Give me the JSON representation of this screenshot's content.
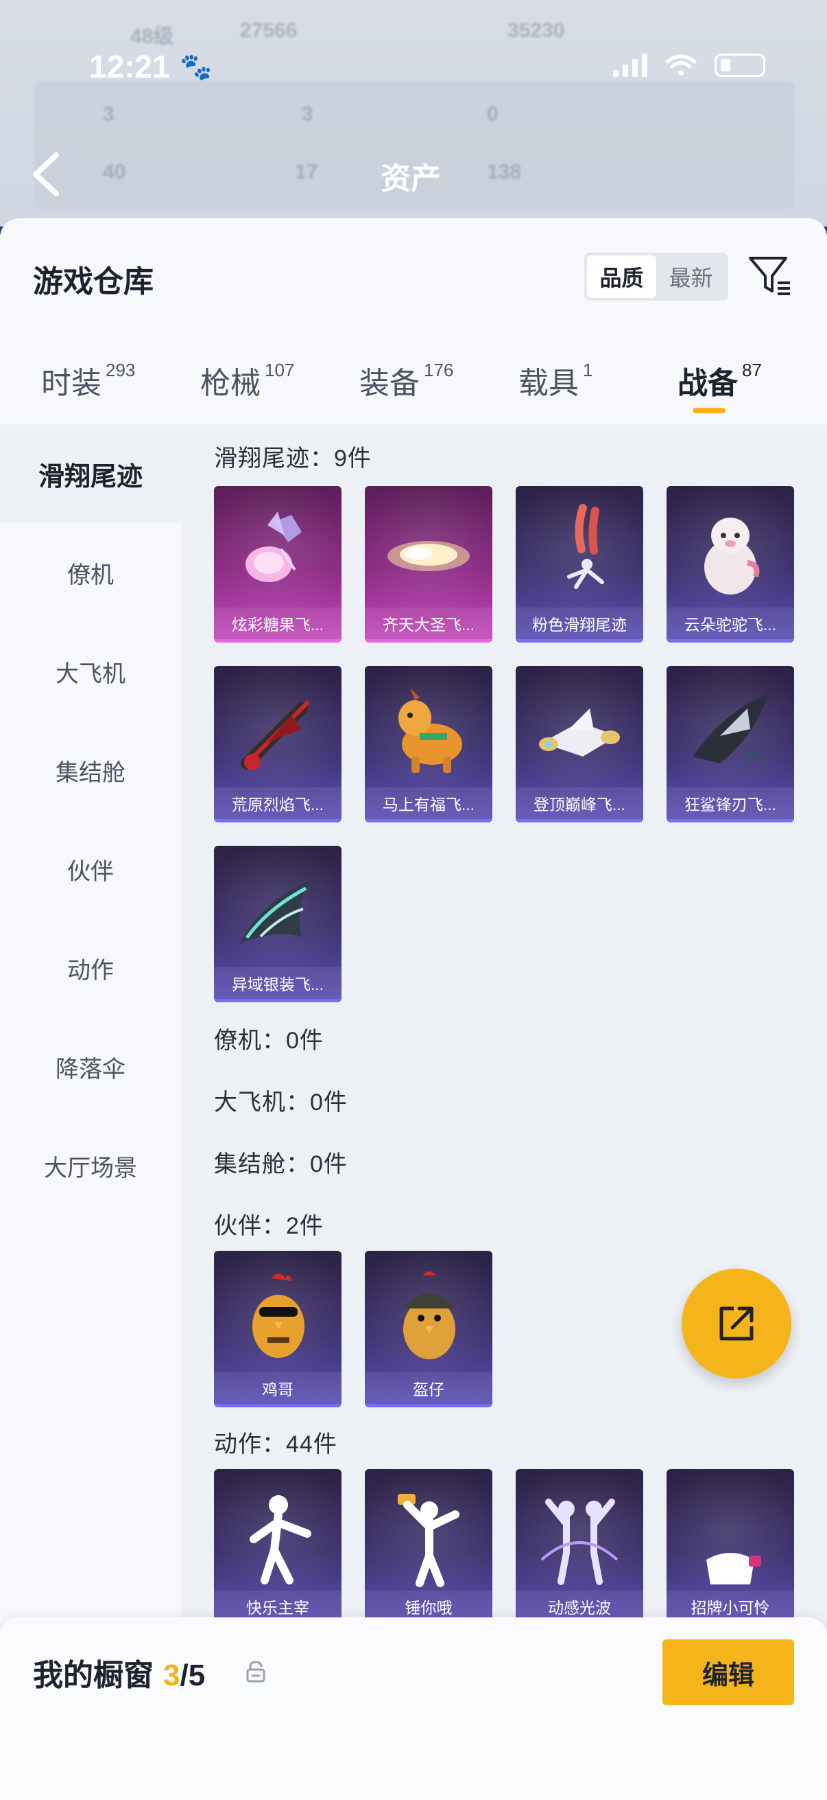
{
  "status": {
    "time": "12:21",
    "paw": "🐾"
  },
  "background": {
    "level": "48级",
    "score1": "27566",
    "score2": "35230",
    "stat1": "3",
    "stat2": "3",
    "stat3": "0",
    "stat4": "40",
    "stat5": "17",
    "stat6": "138",
    "assets_title": "资产"
  },
  "sheet": {
    "title": "游戏仓库",
    "sort": {
      "quality": "品质",
      "latest": "最新"
    }
  },
  "tabs": [
    {
      "label": "时装",
      "count": "293"
    },
    {
      "label": "枪械",
      "count": "107"
    },
    {
      "label": "装备",
      "count": "176"
    },
    {
      "label": "载具",
      "count": "1"
    },
    {
      "label": "战备",
      "count": "87"
    }
  ],
  "sidebar": [
    {
      "label": "滑翔尾迹"
    },
    {
      "label": "僚机"
    },
    {
      "label": "大飞机"
    },
    {
      "label": "集结舱"
    },
    {
      "label": "伙伴"
    },
    {
      "label": "动作"
    },
    {
      "label": "降落伞"
    },
    {
      "label": "大厅场景"
    }
  ],
  "sections": {
    "glide": "滑翔尾迹：9件",
    "wingman": "僚机：0件",
    "bigplane": "大飞机：0件",
    "capsule": "集结舱：0件",
    "partner": "伙伴：2件",
    "action": "动作：44件"
  },
  "glide_items": [
    {
      "name": "炫彩糖果飞...",
      "rarity": "pink",
      "icon": "candy-bouquet-icon"
    },
    {
      "name": "齐天大圣飞...",
      "rarity": "pink",
      "icon": "golden-cloud-icon"
    },
    {
      "name": "粉色滑翔尾迹",
      "rarity": "purple",
      "icon": "pink-smoke-trail-icon"
    },
    {
      "name": "云朵驼驼飞...",
      "rarity": "purple",
      "icon": "alpaca-icon"
    },
    {
      "name": "荒原烈焰飞...",
      "rarity": "purple",
      "icon": "flame-glider-icon"
    },
    {
      "name": "马上有福飞...",
      "rarity": "purple",
      "icon": "horse-glider-icon"
    },
    {
      "name": "登顶巅峰飞...",
      "rarity": "purple",
      "icon": "jet-glider-icon"
    },
    {
      "name": "狂鲨锋刃飞...",
      "rarity": "purple",
      "icon": "shark-glider-icon"
    },
    {
      "name": "异域银装飞...",
      "rarity": "purple",
      "icon": "silver-wing-icon"
    }
  ],
  "partner_items": [
    {
      "name": "鸡哥",
      "rarity": "purple",
      "icon": "chicken-sunglasses-icon"
    },
    {
      "name": "盔仔",
      "rarity": "purple",
      "icon": "chicken-helmet-icon"
    }
  ],
  "action_items": [
    {
      "name": "快乐主宰",
      "rarity": "purple",
      "icon": "dance-pose-icon"
    },
    {
      "name": "锤你哦",
      "rarity": "purple",
      "icon": "hammer-pose-icon"
    },
    {
      "name": "动感光波",
      "rarity": "purple",
      "icon": "light-wave-pose-icon"
    },
    {
      "name": "招牌小可怜",
      "rarity": "purple",
      "icon": "pitiful-pose-icon"
    }
  ],
  "bottom": {
    "title": "我的橱窗",
    "used": "3",
    "total": "/5",
    "edit": "编辑"
  },
  "colors": {
    "accent": "#f4b319",
    "purple_card": "#3e3270",
    "pink_card": "#8b2a84",
    "sheet_bg": "#edf0f5"
  }
}
